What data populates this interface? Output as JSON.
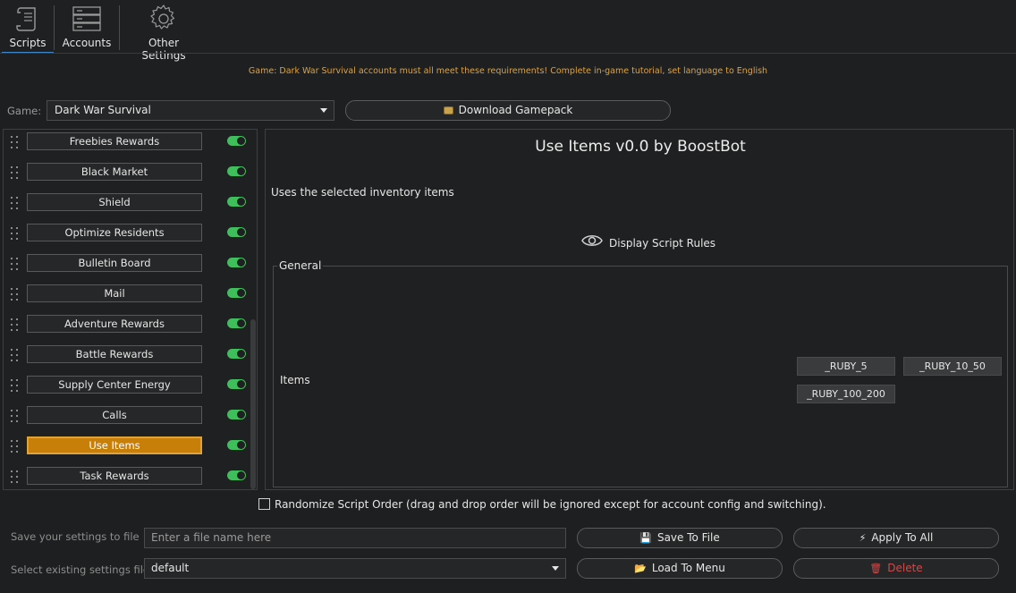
{
  "toolbar": {
    "tabs": [
      {
        "label": "Scripts",
        "icon": "scroll-icon"
      },
      {
        "label": "Accounts",
        "icon": "server-icon"
      },
      {
        "label": "Other Settings",
        "icon": "gear-icon"
      }
    ],
    "active_tab": "Scripts"
  },
  "notice": "Game: Dark War Survival accounts must all meet these requirements! Complete in-game tutorial, set language to English",
  "game": {
    "label": "Game:",
    "selected": "Dark War Survival",
    "download_label": "Download Gamepack"
  },
  "scripts": [
    {
      "label": "Freebies Rewards",
      "enabled": true
    },
    {
      "label": "Black Market",
      "enabled": true
    },
    {
      "label": "Shield",
      "enabled": true
    },
    {
      "label": "Optimize Residents",
      "enabled": true
    },
    {
      "label": "Bulletin Board",
      "enabled": true
    },
    {
      "label": "Mail",
      "enabled": true
    },
    {
      "label": "Adventure Rewards",
      "enabled": true
    },
    {
      "label": "Battle Rewards",
      "enabled": true
    },
    {
      "label": "Supply Center Energy",
      "enabled": true
    },
    {
      "label": "Calls",
      "enabled": true
    },
    {
      "label": "Use Items",
      "enabled": true,
      "selected": true
    },
    {
      "label": "Task Rewards",
      "enabled": true
    }
  ],
  "detail": {
    "title": "Use Items v0.0 by BoostBot",
    "description": "Uses the selected inventory items",
    "rules_label": "Display Script Rules",
    "group_label": "General",
    "items_label": "Items",
    "items": [
      "_RUBY_5",
      "_RUBY_10_50",
      "_RUBY_100_200"
    ]
  },
  "randomize_label": "Randomize Script Order (drag and drop order will be ignored except for account config and switching).",
  "randomize_checked": false,
  "save": {
    "label": "Save your settings to file",
    "placeholder": "Enter a file name here",
    "button": "Save To File",
    "apply_button": "Apply To All"
  },
  "load": {
    "label": "Select existing settings file",
    "selected": "default",
    "button": "Load To Menu",
    "delete_button": "Delete"
  },
  "colors": {
    "accent": "#c87f0a",
    "toggle_on": "#3fbf5c",
    "notice": "#e0a23a",
    "danger": "#d04a4a",
    "tab_underline": "#3e86c9"
  }
}
